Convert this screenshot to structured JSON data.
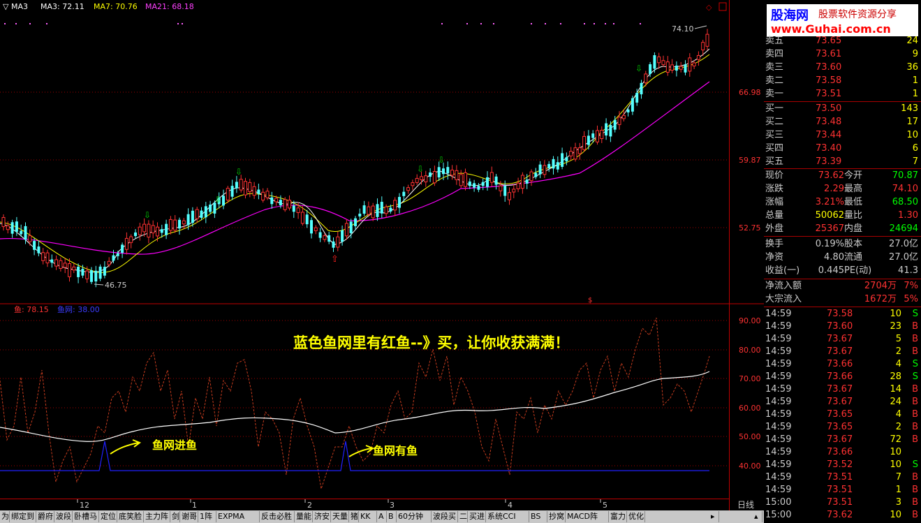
{
  "main_header": {
    "indicator": "MA3",
    "ma3": "MA3: 72.11",
    "ma7": "MA7: 70.76",
    "ma21": "MA21: 68.18"
  },
  "price_axis": [
    "66.98",
    "59.87",
    "52.75"
  ],
  "price_markers": {
    "high": "74.10",
    "low": "46.75"
  },
  "sub_header": {
    "label1": "鱼: 78.15",
    "label2": "鱼网: 38.00"
  },
  "sub_axis": [
    "90.00",
    "80.00",
    "70.00",
    "60.00",
    "50.00",
    "40.00"
  ],
  "annotations": {
    "headline": "蓝色鱼网里有红鱼--》买，让你收获满满！",
    "catch1": "鱼网进鱼",
    "catch2": "鱼网有鱼"
  },
  "date_axis": [
    "12",
    "1",
    "2",
    "3",
    "4",
    "5"
  ],
  "period": "日线",
  "brand": {
    "name": "股海网",
    "slogan": "股票软件资源分享",
    "url": "www.Guhai.com.cn"
  },
  "order_book": {
    "asks": [
      {
        "label": "卖五",
        "price": "73.65",
        "vol": "24"
      },
      {
        "label": "卖四",
        "price": "73.61",
        "vol": "9"
      },
      {
        "label": "卖三",
        "price": "73.60",
        "vol": "36"
      },
      {
        "label": "卖二",
        "price": "73.58",
        "vol": "1"
      },
      {
        "label": "卖一",
        "price": "73.51",
        "vol": "1"
      }
    ],
    "bids": [
      {
        "label": "买一",
        "price": "73.50",
        "vol": "143"
      },
      {
        "label": "买二",
        "price": "73.48",
        "vol": "17"
      },
      {
        "label": "买三",
        "price": "73.44",
        "vol": "10"
      },
      {
        "label": "买四",
        "price": "73.40",
        "vol": "6"
      },
      {
        "label": "买五",
        "price": "73.39",
        "vol": "7"
      }
    ]
  },
  "quote": [
    {
      "l1": "现价",
      "v1": "73.62",
      "l2": "今开",
      "v2": "70.87"
    },
    {
      "l1": "涨跌",
      "v1": "2.29",
      "l2": "最高",
      "v2": "74.10"
    },
    {
      "l1": "涨幅",
      "v1": "3.21%",
      "l2": "最低",
      "v2": "68.50"
    },
    {
      "l1": "总量",
      "v1": "50062",
      "l2": "量比",
      "v2": "1.30"
    },
    {
      "l1": "外盘",
      "v1": "25367",
      "l2": "内盘",
      "v2": "24694"
    }
  ],
  "fundamentals": [
    {
      "l1": "换手",
      "v1": "0.19%",
      "l2": "股本",
      "v2": "27.0亿"
    },
    {
      "l1": "净资",
      "v1": "4.80",
      "l2": "流通",
      "v2": "27.0亿"
    },
    {
      "l1": "收益(一)",
      "v1": "0.445",
      "l2": "PE(动)",
      "v2": "41.3"
    }
  ],
  "flows": [
    {
      "label": "净流入额",
      "value": "2704万",
      "pct": "7%"
    },
    {
      "label": "大宗流入",
      "value": "1672万",
      "pct": "5%"
    }
  ],
  "ticks": [
    {
      "t": "14:59",
      "p": "73.58",
      "v": "10",
      "s": "S"
    },
    {
      "t": "14:59",
      "p": "73.60",
      "v": "23",
      "s": "B"
    },
    {
      "t": "14:59",
      "p": "73.67",
      "v": "5",
      "s": "B"
    },
    {
      "t": "14:59",
      "p": "73.67",
      "v": "2",
      "s": "B"
    },
    {
      "t": "14:59",
      "p": "73.66",
      "v": "4",
      "s": "S"
    },
    {
      "t": "14:59",
      "p": "73.66",
      "v": "28",
      "s": "S"
    },
    {
      "t": "14:59",
      "p": "73.67",
      "v": "14",
      "s": "B"
    },
    {
      "t": "14:59",
      "p": "73.67",
      "v": "24",
      "s": "B"
    },
    {
      "t": "14:59",
      "p": "73.65",
      "v": "4",
      "s": "B"
    },
    {
      "t": "14:59",
      "p": "73.65",
      "v": "2",
      "s": "B"
    },
    {
      "t": "14:59",
      "p": "73.67",
      "v": "72",
      "s": "B"
    },
    {
      "t": "14:59",
      "p": "73.66",
      "v": "10",
      "s": ""
    },
    {
      "t": "14:59",
      "p": "73.52",
      "v": "10",
      "s": "S"
    },
    {
      "t": "14:59",
      "p": "73.51",
      "v": "7",
      "s": "B"
    },
    {
      "t": "14:59",
      "p": "73.51",
      "v": "1",
      "s": "B"
    },
    {
      "t": "15:00",
      "p": "73.51",
      "v": "3",
      "s": "B"
    },
    {
      "t": "15:00",
      "p": "73.62",
      "v": "10",
      "s": "B"
    }
  ],
  "tabs": [
    "为",
    "绑定到",
    "爵府",
    "波段",
    "卧槽马",
    "定位",
    "底笑脸",
    "主力阵",
    "剑",
    "谢哥",
    "1阵",
    "EXPMA",
    "反击必胜",
    "量能",
    "济安",
    "天量",
    "猪",
    "KK",
    "A",
    "B",
    "60分钟",
    "波段买",
    "二",
    "买进",
    "系统CCI",
    "BS",
    "抄窝",
    "MACD阵",
    "富力",
    "优化"
  ],
  "colors": {
    "up": "#ff3232",
    "down": "#54ffff",
    "ma3": "#ffffff",
    "ma7": "#ffff00",
    "ma21": "#ff00ff",
    "grid": "#a00000",
    "fish": "#c83c1e",
    "net": "#0000ff",
    "axis": "#ff0000"
  }
}
